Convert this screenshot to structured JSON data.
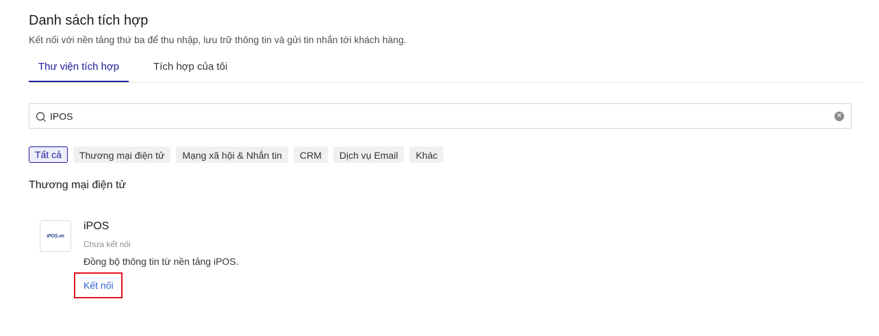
{
  "header": {
    "title": "Danh sách tích hợp",
    "description": "Kết nối với nền tảng thứ ba để thu nhập, lưu trữ thông tin và gửi tin nhắn tới khách hàng."
  },
  "tabs": [
    {
      "label": "Thư viện tích hợp",
      "active": true
    },
    {
      "label": "Tích hợp của tôi",
      "active": false
    }
  ],
  "search": {
    "value": "IPOS",
    "icon": "search-icon",
    "clear_icon": "clear-icon"
  },
  "filters": [
    {
      "label": "Tất cả",
      "active": true
    },
    {
      "label": "Thương mại điện tử",
      "active": false
    },
    {
      "label": "Mạng xã hội & Nhắn tin",
      "active": false
    },
    {
      "label": "CRM",
      "active": false
    },
    {
      "label": "Dịch vụ Email",
      "active": false
    },
    {
      "label": "Khác",
      "active": false
    }
  ],
  "section": {
    "title": "Thương mại điện tử"
  },
  "integration": {
    "logo_text": "iPOS.vn",
    "name": "iPOS",
    "status": "Chưa kết nối",
    "description": "Đồng bộ thông tin từ nền tảng iPOS.",
    "action_label": "Kết nối"
  },
  "colors": {
    "accent": "#1f1a9c",
    "link": "#2f5fd1",
    "highlight": "#e0131b"
  }
}
